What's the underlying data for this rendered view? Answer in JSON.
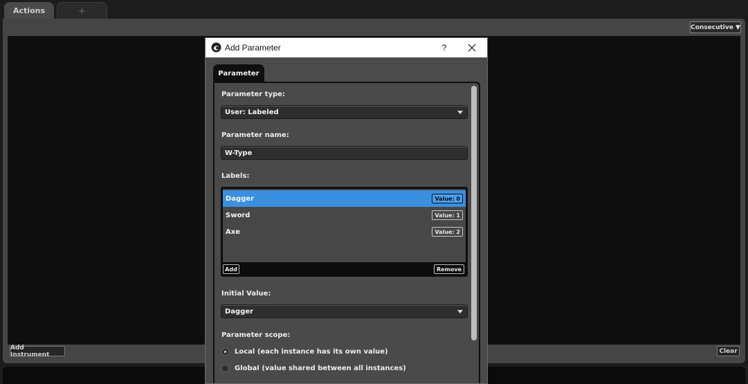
{
  "tabs": {
    "actions": "Actions",
    "add": "+"
  },
  "toolbar": {
    "mode": "Consecutive ▼"
  },
  "footer": {
    "add_instrument": "Add Instrument",
    "clear": "Clear"
  },
  "dialog": {
    "title": "Add Parameter",
    "help": "?",
    "tab": "Parameter",
    "parameter_type_label": "Parameter type:",
    "parameter_type_value": "User: Labeled",
    "parameter_name_label": "Parameter name:",
    "parameter_name_value": "W-Type",
    "labels_label": "Labels:",
    "labels": [
      {
        "name": "Dagger",
        "value": "Value: 0",
        "selected": true
      },
      {
        "name": "Sword",
        "value": "Value: 1",
        "selected": false
      },
      {
        "name": "Axe",
        "value": "Value: 2",
        "selected": false
      }
    ],
    "add_label": "Add",
    "remove_label": "Remove",
    "initial_value_label": "Initial Value:",
    "initial_value": "Dagger",
    "scope_label": "Parameter scope:",
    "scope_local": "Local (each instance has its own value)",
    "scope_global": "Global (value shared between all instances)",
    "scope_selected": "local"
  },
  "colors": {
    "selection": "#3a8fe0",
    "panel": "#454545",
    "canvas": "#0e0e0e"
  }
}
